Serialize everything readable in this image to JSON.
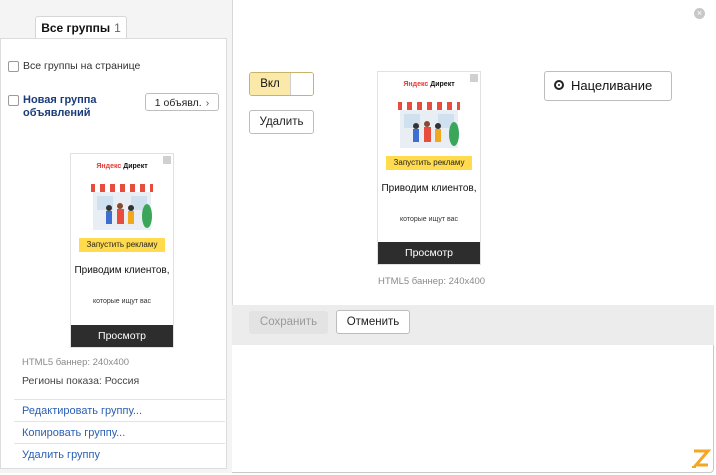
{
  "tab": {
    "label": "Все группы",
    "count": "1"
  },
  "checkbox_all_label": "Все группы на странице",
  "group": {
    "name": "Новая группа объявлений",
    "ads_button": "1 объявл."
  },
  "banner": {
    "logo_brand": "Яндекс",
    "logo_product": "Директ",
    "cta": "Запустить рекламу",
    "headline": "Приводим клиентов,",
    "subtext": "которые ищут вас",
    "view_label": "Просмотр",
    "caption": "HTML5 баннер: 240x400"
  },
  "regions": "Регионы показа: Россия",
  "links": {
    "edit": "Редактировать группу...",
    "copy": "Копировать группу...",
    "delete": "Удалить группу"
  },
  "editor": {
    "toggle_label": "Вкл",
    "delete_label": "Удалить",
    "targeting_label": "Нацеливание",
    "save_label": "Сохранить",
    "cancel_label": "Отменить"
  },
  "colors": {
    "accent_yellow": "#ffdb4d",
    "toggle_bg": "#fbe9a9",
    "link": "#2b5fb3",
    "group_title": "#1a3c7a",
    "brand_orange": "#f5a623"
  },
  "icons": {
    "close": "close-icon",
    "target": "target-icon",
    "chevron": "chevron-right-icon",
    "brand": "brand-z-icon"
  }
}
